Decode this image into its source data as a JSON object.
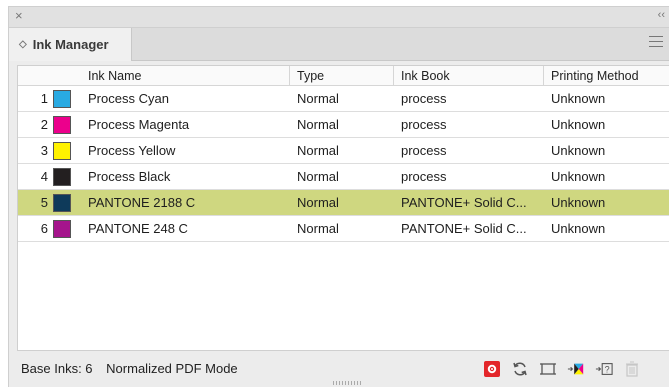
{
  "panel": {
    "close_glyph": "×",
    "collapse_glyph": "‹‹",
    "tab_title": "Ink Manager",
    "tab_arrows": "◇"
  },
  "columns": [
    "Ink Name",
    "Type",
    "Ink Book",
    "Printing Method"
  ],
  "inks": [
    {
      "num": "1",
      "swatch": "#29aae2",
      "name": "Process Cyan",
      "type": "Normal",
      "book": "process",
      "method": "Unknown",
      "selected": false
    },
    {
      "num": "2",
      "swatch": "#ec008c",
      "name": "Process Magenta",
      "type": "Normal",
      "book": "process",
      "method": "Unknown",
      "selected": false
    },
    {
      "num": "3",
      "swatch": "#fff200",
      "name": "Process Yellow",
      "type": "Normal",
      "book": "process",
      "method": "Unknown",
      "selected": false
    },
    {
      "num": "4",
      "swatch": "#231f20",
      "name": "Process Black",
      "type": "Normal",
      "book": "process",
      "method": "Unknown",
      "selected": false
    },
    {
      "num": "5",
      "swatch": "#0e3a5a",
      "name": "PANTONE 2188 C",
      "type": "Normal",
      "book": "PANTONE+ Solid C...",
      "method": "Unknown",
      "selected": true
    },
    {
      "num": "6",
      "swatch": "#a5148c",
      "name": "PANTONE 248 C",
      "type": "Normal",
      "book": "PANTONE+ Solid C...",
      "method": "Unknown",
      "selected": false
    }
  ],
  "status": {
    "base_inks": "Base Inks: 6",
    "mode": "Normalized PDF Mode"
  },
  "colors": {
    "selected_row": "#cfd780",
    "accent_red": "#e3262a"
  },
  "tools": [
    "settings-icon",
    "refresh-icon",
    "frame-icon",
    "ink-to-process-icon",
    "ink-unknown-icon",
    "trash-icon"
  ]
}
